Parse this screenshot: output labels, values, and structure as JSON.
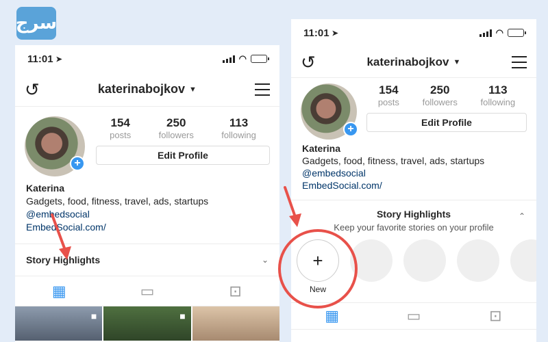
{
  "logo_text": "السرج",
  "status_bar": {
    "time": "11:01",
    "location_glyph": "➤"
  },
  "profile": {
    "username": "katerinabojkov",
    "posts_count": "154",
    "posts_label": "posts",
    "followers_count": "250",
    "followers_label": "followers",
    "following_count": "113",
    "following_label": "following",
    "edit_button": "Edit Profile",
    "name": "Katerina",
    "bio": "Gadgets, food, fitness, travel, ads, startups",
    "handle": "@embedsocial",
    "website": "EmbedSocial.com/"
  },
  "highlights": {
    "title": "Story Highlights",
    "subtitle": "Keep your favorite stories on your profile",
    "new_label": "New"
  },
  "icons": {
    "history": "history-icon",
    "menu": "menu-icon",
    "grid": "grid-icon",
    "feed": "feed-icon",
    "tagged": "tagged-icon"
  },
  "colors": {
    "accent": "#3897f0",
    "annotation": "#e8514a",
    "link": "#003569"
  }
}
